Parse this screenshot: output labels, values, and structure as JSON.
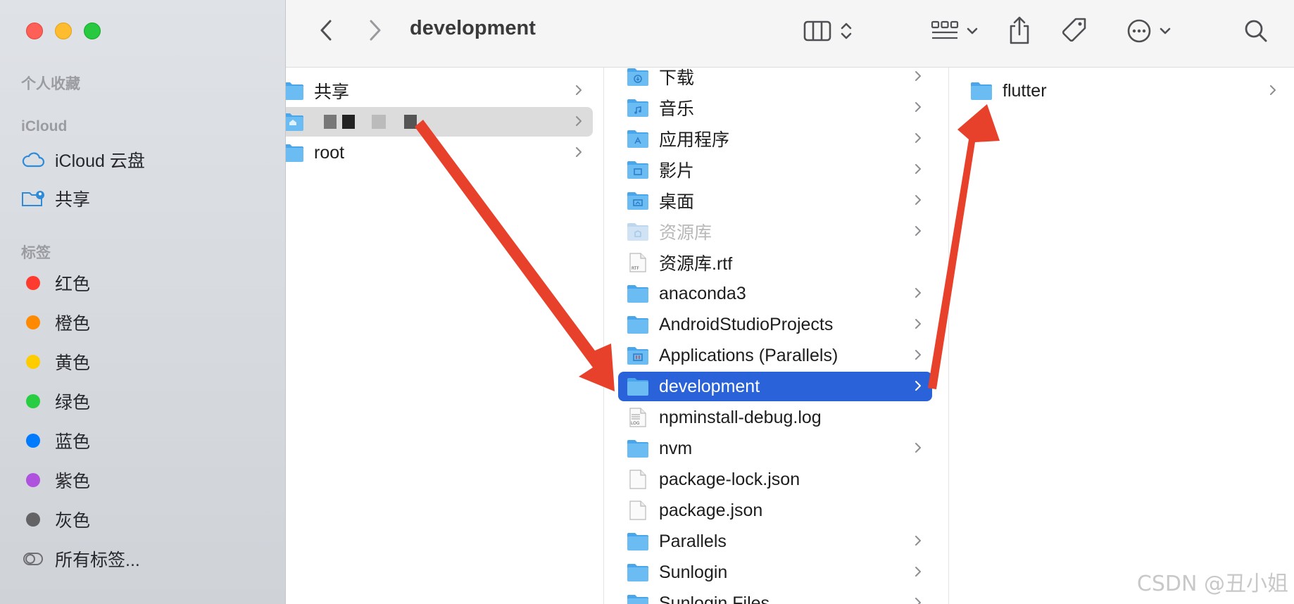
{
  "window": {
    "title": "development"
  },
  "sidebar": {
    "sections": {
      "favorites": "个人收藏",
      "icloud": "iCloud",
      "tags": "标签"
    },
    "icloud_items": [
      {
        "label": "iCloud 云盘",
        "icon": "icloud-drive-icon"
      },
      {
        "label": "共享",
        "icon": "shared-folder-icon"
      }
    ],
    "tags": [
      {
        "label": "红色",
        "color": "#ff3b30"
      },
      {
        "label": "橙色",
        "color": "#ff8a00"
      },
      {
        "label": "黄色",
        "color": "#ffcc00"
      },
      {
        "label": "绿色",
        "color": "#28cd41"
      },
      {
        "label": "蓝色",
        "color": "#007aff"
      },
      {
        "label": "紫色",
        "color": "#af52de"
      },
      {
        "label": "灰色",
        "color": "#636366"
      }
    ],
    "all_tags": "所有标签..."
  },
  "toolbar": {
    "back": "chevron-left-icon",
    "forward": "chevron-right-icon",
    "view": "column-view-icon",
    "group": "group-grid-icon",
    "share": "share-icon",
    "tag": "tag-icon",
    "more": "ellipsis-circle-icon",
    "search": "search-icon"
  },
  "column1": [
    {
      "name": "共享",
      "type": "folder",
      "chevron": true
    },
    {
      "name": "",
      "type": "home",
      "chevron": true,
      "redacted": true
    },
    {
      "name": "root",
      "type": "folder",
      "chevron": true
    }
  ],
  "column2": [
    {
      "name": "下载",
      "type": "folder-downloads",
      "chevron": true
    },
    {
      "name": "音乐",
      "type": "folder-music",
      "chevron": true
    },
    {
      "name": "应用程序",
      "type": "folder-apps",
      "chevron": true
    },
    {
      "name": "影片",
      "type": "folder-movies",
      "chevron": true
    },
    {
      "name": "桌面",
      "type": "folder-desktop",
      "chevron": true
    },
    {
      "name": "资源库",
      "type": "folder-library",
      "chevron": true,
      "dimmed": true
    },
    {
      "name": "资源库.rtf",
      "type": "file-rtf",
      "chevron": false
    },
    {
      "name": "anaconda3",
      "type": "folder",
      "chevron": true
    },
    {
      "name": "AndroidStudioProjects",
      "type": "folder",
      "chevron": true
    },
    {
      "name": "Applications (Parallels)",
      "type": "folder-parallels",
      "chevron": true
    },
    {
      "name": "development",
      "type": "folder",
      "chevron": true,
      "selected": true
    },
    {
      "name": "npminstall-debug.log",
      "type": "file-log",
      "chevron": false
    },
    {
      "name": "nvm",
      "type": "folder",
      "chevron": true
    },
    {
      "name": "package-lock.json",
      "type": "file",
      "chevron": false
    },
    {
      "name": "package.json",
      "type": "file",
      "chevron": false
    },
    {
      "name": "Parallels",
      "type": "folder",
      "chevron": true
    },
    {
      "name": "Sunlogin",
      "type": "folder",
      "chevron": true
    },
    {
      "name": "Sunlogin Files",
      "type": "folder",
      "chevron": true
    }
  ],
  "column3": [
    {
      "name": "flutter",
      "type": "folder",
      "chevron": true
    }
  ],
  "watermark": "CSDN @丑小姐",
  "colors": {
    "selection": "#2a62d9",
    "folder": "#5fb3f0",
    "annotation_arrow": "#e8412b"
  }
}
